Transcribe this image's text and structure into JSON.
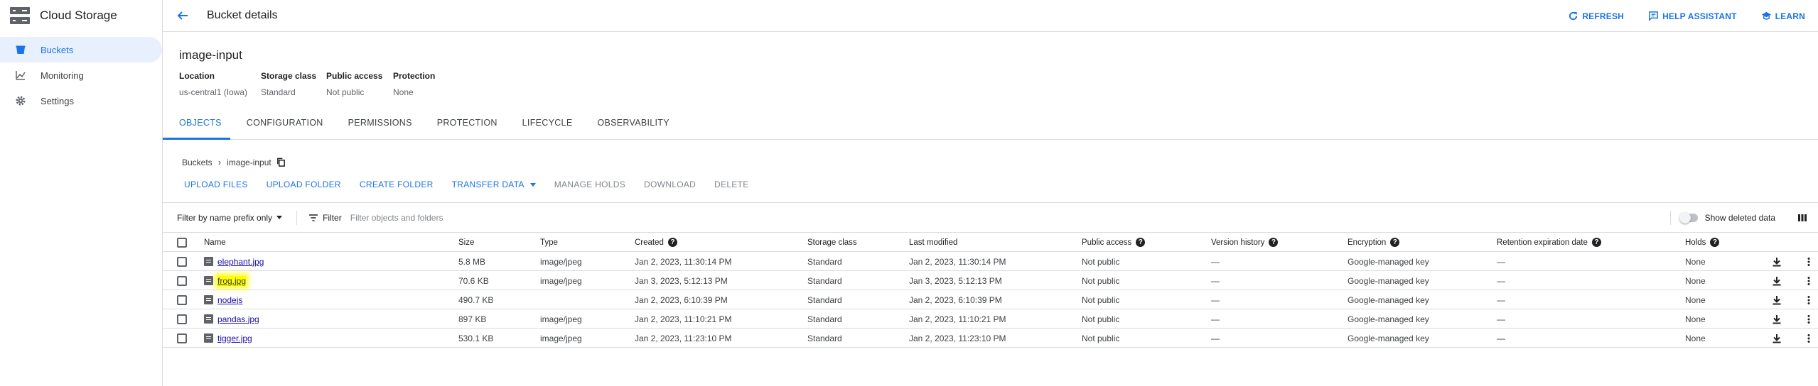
{
  "app": {
    "title": "Cloud Storage",
    "nav": [
      {
        "label": "Buckets",
        "icon": "bucket-icon",
        "active": true
      },
      {
        "label": "Monitoring",
        "icon": "chart-icon",
        "active": false
      },
      {
        "label": "Settings",
        "icon": "gear-icon",
        "active": false
      }
    ]
  },
  "header": {
    "title": "Bucket details",
    "refresh": "REFRESH",
    "help_assistant": "HELP ASSISTANT",
    "learn": "LEARN"
  },
  "bucket": {
    "name": "image-input",
    "meta": [
      {
        "label": "Location",
        "value": "us-central1 (Iowa)"
      },
      {
        "label": "Storage class",
        "value": "Standard"
      },
      {
        "label": "Public access",
        "value": "Not public"
      },
      {
        "label": "Protection",
        "value": "None"
      }
    ]
  },
  "tabs": [
    "OBJECTS",
    "CONFIGURATION",
    "PERMISSIONS",
    "PROTECTION",
    "LIFECYCLE",
    "OBSERVABILITY"
  ],
  "breadcrumb": {
    "root": "Buckets",
    "current": "image-input"
  },
  "actions": {
    "upload_files": "UPLOAD FILES",
    "upload_folder": "UPLOAD FOLDER",
    "create_folder": "CREATE FOLDER",
    "transfer_data": "TRANSFER DATA",
    "manage_holds": "MANAGE HOLDS",
    "download": "DOWNLOAD",
    "delete": "DELETE"
  },
  "filter": {
    "prefix_mode": "Filter by name prefix only",
    "label": "Filter",
    "placeholder": "Filter objects and folders",
    "show_deleted": "Show deleted data"
  },
  "table": {
    "columns": {
      "name": "Name",
      "size": "Size",
      "type": "Type",
      "created": "Created",
      "storage_class": "Storage class",
      "last_modified": "Last modified",
      "public_access": "Public access",
      "version_history": "Version history",
      "encryption": "Encryption",
      "retention": "Retention expiration date",
      "holds": "Holds"
    },
    "rows": [
      {
        "name": "elephant.jpg",
        "size": "5.8 MB",
        "type": "image/jpeg",
        "created": "Jan 2, 2023, 11:30:14 PM",
        "storage_class": "Standard",
        "last_modified": "Jan 2, 2023, 11:30:14 PM",
        "public_access": "Not public",
        "version_history": "—",
        "encryption": "Google-managed key",
        "retention": "—",
        "holds": "None"
      },
      {
        "name": "frog.jpg",
        "size": "70.6 KB",
        "type": "image/jpeg",
        "created": "Jan 3, 2023, 5:12:13 PM",
        "storage_class": "Standard",
        "last_modified": "Jan 3, 2023, 5:12:13 PM",
        "public_access": "Not public",
        "version_history": "—",
        "encryption": "Google-managed key",
        "retention": "—",
        "holds": "None"
      },
      {
        "name": "nodejs",
        "size": "490.7 KB",
        "type": "",
        "created": "Jan 2, 2023, 6:10:39 PM",
        "storage_class": "Standard",
        "last_modified": "Jan 2, 2023, 6:10:39 PM",
        "public_access": "Not public",
        "version_history": "—",
        "encryption": "Google-managed key",
        "retention": "—",
        "holds": "None"
      },
      {
        "name": "pandas.jpg",
        "size": "897 KB",
        "type": "image/jpeg",
        "created": "Jan 2, 2023, 11:10:21 PM",
        "storage_class": "Standard",
        "last_modified": "Jan 2, 2023, 11:10:21 PM",
        "public_access": "Not public",
        "version_history": "—",
        "encryption": "Google-managed key",
        "retention": "—",
        "holds": "None"
      },
      {
        "name": "tigger.jpg",
        "size": "530.1 KB",
        "type": "image/jpeg",
        "created": "Jan 2, 2023, 11:23:10 PM",
        "storage_class": "Standard",
        "last_modified": "Jan 2, 2023, 11:23:10 PM",
        "public_access": "Not public",
        "version_history": "—",
        "encryption": "Google-managed key",
        "retention": "—",
        "holds": "None"
      }
    ]
  },
  "colors": {
    "accent": "#1a73e8",
    "highlight": "#ffff00",
    "border": "#dadce0",
    "active_nav_bg": "#e8f0fe"
  }
}
